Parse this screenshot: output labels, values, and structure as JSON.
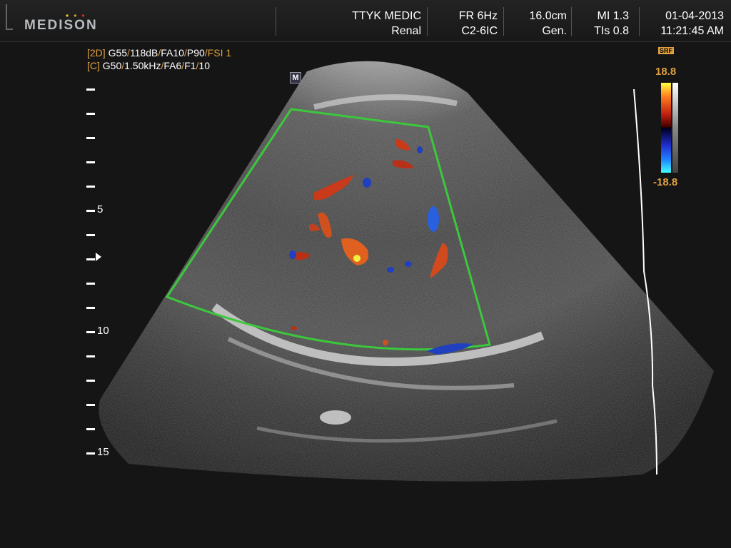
{
  "header": {
    "logo": "MEDISON",
    "institution": "TTYK MEDIC",
    "study": "Renal",
    "frame_rate": "FR 6Hz",
    "probe": "C2-6IC",
    "depth": "16.0cm",
    "mode": "Gen.",
    "mi": "MI 1.3",
    "tis": "TIs 0.8",
    "date": "01-04-2013",
    "time": "11:21:45 AM"
  },
  "params": {
    "line1_tag": "[2D]",
    "line1_a": " G55",
    "line1_b": "/",
    "line1_c": "118dB",
    "line1_d": "/",
    "line1_e": "FA10",
    "line1_f": "/",
    "line1_g": "P90",
    "line1_h": "/",
    "line1_i": "FSI 1",
    "line2_tag": "[C]",
    "line2_a": " G50",
    "line2_b": "/",
    "line2_c": "1.50kHz",
    "line2_d": "/",
    "line2_e": "FA6",
    "line2_f": "/",
    "line2_g": "F1",
    "line2_h": "/",
    "line2_i": "10"
  },
  "m_marker": "M",
  "depth_scale": {
    "labels": [
      "5",
      "10",
      "15"
    ]
  },
  "color_map": {
    "badge": "SRF",
    "max": "18.8",
    "min": "-18.8"
  },
  "colors": {
    "roi_box": "#3cc83c",
    "annotation": "#e0a040"
  }
}
